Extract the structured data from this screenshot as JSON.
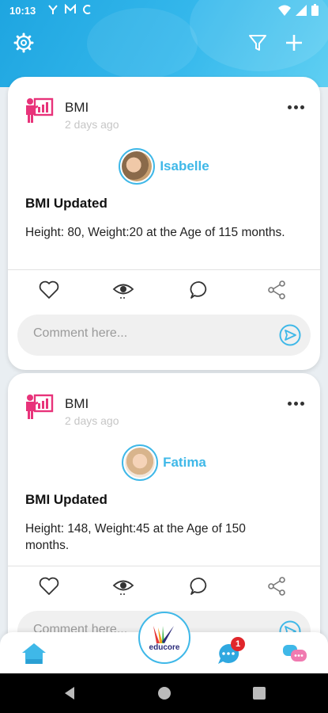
{
  "status_bar": {
    "time": "10:13"
  },
  "feed": [
    {
      "type_label": "BMI",
      "time_ago": "2 days ago",
      "student_name": "Isabelle",
      "title": "BMI Updated",
      "body": "Height: 80, Weight:20 at the Age of 115 months.",
      "comment_placeholder": "Comment here..."
    },
    {
      "type_label": "BMI",
      "time_ago": "2 days ago",
      "student_name": "Fatima",
      "title": "BMI Updated",
      "body": "Height: 148, Weight:45 at the Age of 150 months.",
      "comment_placeholder": "Comment here..."
    }
  ],
  "bottom_nav": {
    "logo_text": "educore",
    "notification_count": "1"
  },
  "colors": {
    "accent": "#3fb8e8",
    "header": "#1ea5e0",
    "bmi_icon": "#e8337a",
    "badge": "#e0262b"
  },
  "icons": [
    "settings-icon",
    "filter-icon",
    "add-icon",
    "bmi-chart-icon",
    "more-icon",
    "heart-icon",
    "eye-icon",
    "comment-icon",
    "share-icon",
    "send-icon",
    "home-icon",
    "chat-bubble-icon",
    "messages-icon"
  ]
}
